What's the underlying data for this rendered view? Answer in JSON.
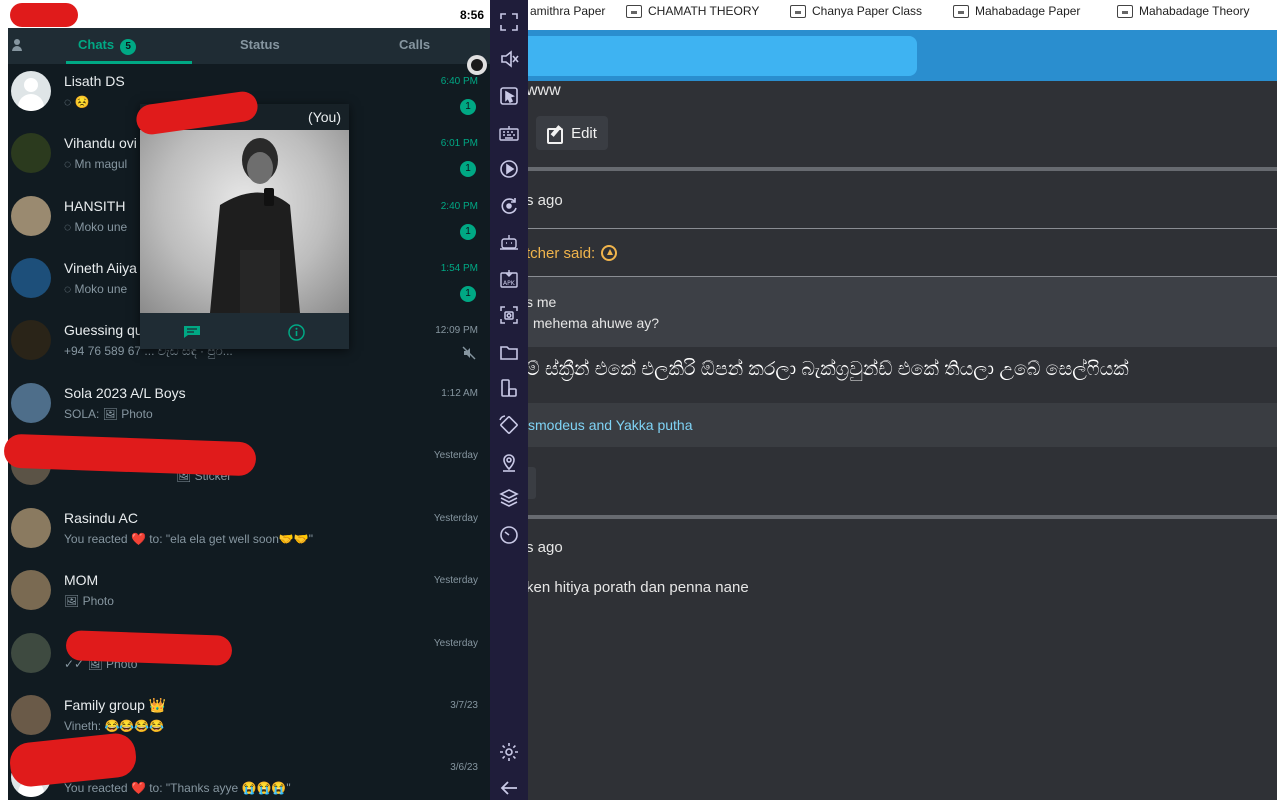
{
  "bookmarks": [
    {
      "label": "amithra Paper"
    },
    {
      "label": "CHAMATH THEORY"
    },
    {
      "label": "Chanya Paper Class"
    },
    {
      "label": "Mahabadage Paper"
    },
    {
      "label": "Mahabadage Theory"
    }
  ],
  "phone": {
    "clock": "8:56",
    "tabs": {
      "chats": "Chats",
      "chats_badge": "5",
      "status": "Status",
      "calls": "Calls"
    },
    "chats": [
      {
        "name": "Lisath DS",
        "preview": "◌ 😣",
        "time": "6:40 PM",
        "unread": "1"
      },
      {
        "name": "Vihandu ovi",
        "preview": "◌ Mn magul",
        "time": "6:01 PM",
        "unread": "1"
      },
      {
        "name": "HANSITH",
        "preview": "◌ Moko une",
        "time": "2:40 PM",
        "unread": "1"
      },
      {
        "name": "Vineth Aiiya",
        "preview": "◌ Moko une",
        "time": "1:54 PM",
        "unread": "1"
      },
      {
        "name": "Guessing qu",
        "preview": "+94 76 589 67",
        "preview_tail": "... වැඩ සඳ · පුර්...",
        "time": "12:09 PM"
      },
      {
        "name": "Sola 2023 A/L Boys",
        "preview": "SOLA: 🖼 Photo",
        "time": "1:12 AM"
      },
      {
        "name": "",
        "preview": "🖼 Sticker",
        "time": "Yesterday"
      },
      {
        "name": "Rasindu AC",
        "preview": "You reacted ❤️ to: \"ela ela get well soon🤝🤝\"",
        "time": "Yesterday"
      },
      {
        "name": "MOM",
        "preview": "🖼 Photo",
        "time": "Yesterday"
      },
      {
        "name": "",
        "preview": "✓✓ 🖼 Photo",
        "time": "Yesterday"
      },
      {
        "name": "Family group 👑",
        "preview": "Vineth: 😂😂😂😂",
        "time": "3/7/23"
      },
      {
        "name": "",
        "preview": "You reacted ❤️ to: \"Thanks ayye 😭😭😭\"",
        "time": "3/6/23"
      }
    ],
    "popup": {
      "title": "(You)"
    }
  },
  "forum": {
    "top_text": "www",
    "edit_label": "Edit",
    "post1_time": "s ago",
    "quote_author": "tcher said:",
    "quote_line1": "s me",
    "quote_line2": "mehema ahuwe ay?",
    "sinhala_text": "ම් ස්ක්‍රීන් එකේ එලකිරි ඕපන් කරලා බැක්ග්‍රවුන්ඩ් එකේ තියලා උබේ සෙල්ෆියක්",
    "likes": "smodeus and Yakka putha",
    "post2_time": "s ago",
    "post2_text": "ken hitiya porath dan penna nane"
  },
  "colors": {
    "whatsapp_green": "#00a884",
    "whatsapp_bg": "#111b21",
    "forum_bg": "#2f3136",
    "forum_header": "#2a8ecf",
    "toolbar_bg": "#1f1d3a",
    "redaction": "#e01b1b"
  },
  "toolbar_icons": [
    "fullscreen-icon",
    "volume-mute-icon",
    "pointer-icon",
    "keyboard-icon",
    "record-icon",
    "rotate-icon",
    "robot-icon",
    "apk-icon",
    "screenshot-icon",
    "folder-icon",
    "multi-window-icon",
    "rotate-screen-icon",
    "location-icon",
    "layers-icon",
    "performance-icon",
    "settings-icon",
    "back-arrow-icon"
  ]
}
